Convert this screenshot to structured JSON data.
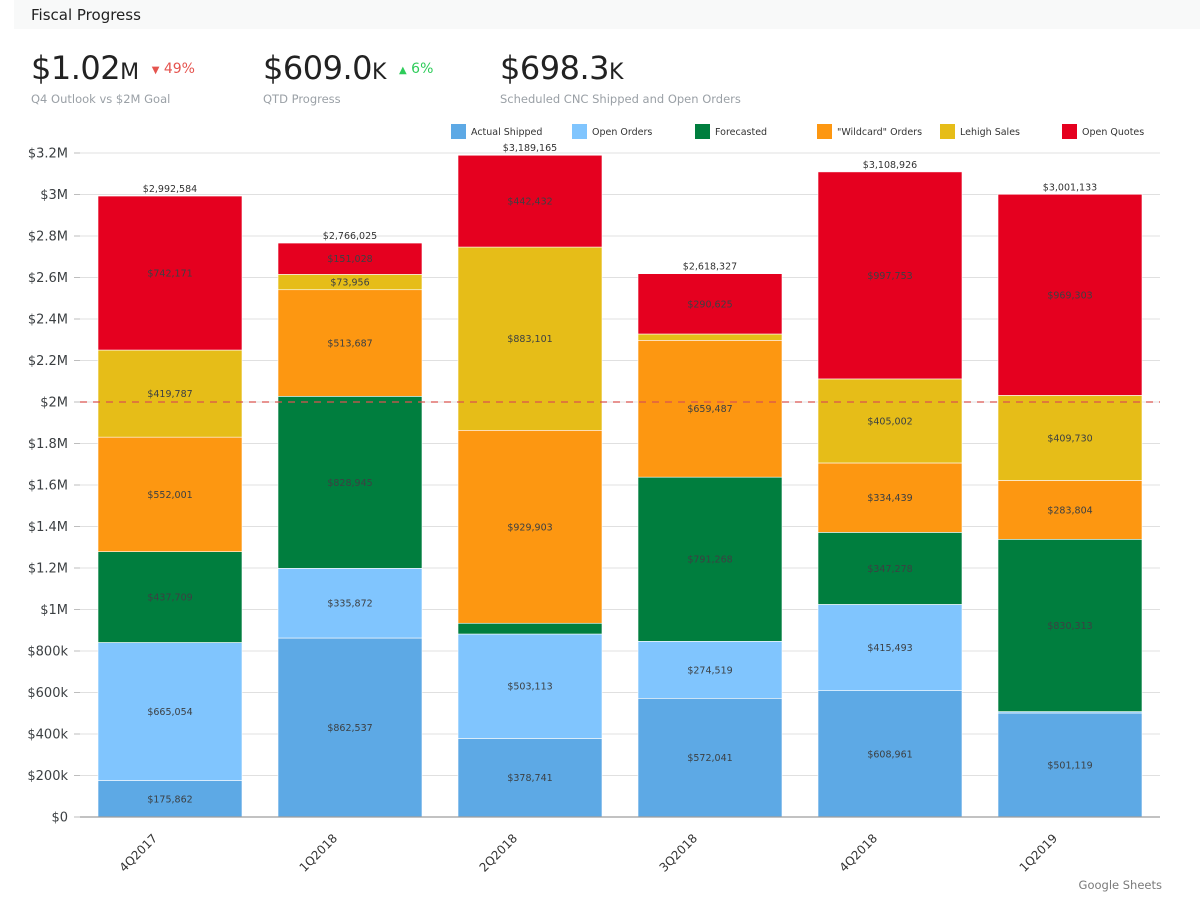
{
  "page": {
    "title": "Fiscal Progress",
    "footer": "Google Sheets"
  },
  "kpis": [
    {
      "value": "$1.02",
      "suffix": "M",
      "delta": "49%",
      "delta_direction": "down",
      "delta_icon": "triangle-down-icon",
      "label": "Q4 Outlook vs $2M Goal"
    },
    {
      "value": "$609.0",
      "suffix": "K",
      "delta": "6%",
      "delta_direction": "up",
      "delta_icon": "triangle-up-icon",
      "label": "QTD Progress"
    },
    {
      "value": "$698.3",
      "suffix": "K",
      "delta": "",
      "delta_direction": "",
      "delta_icon": "",
      "label": "Scheduled CNC Shipped and Open Orders"
    }
  ],
  "colors": {
    "down": "#e5544f",
    "up": "#2ecc5a",
    "goal_line": "#d9534f",
    "gridline": "#e0e0e0",
    "axis": "#9e9e9e"
  },
  "chart_data": {
    "type": "bar",
    "stacked": true,
    "title": "",
    "xlabel": "",
    "ylabel": "",
    "ylim": [
      0,
      3200000
    ],
    "y_ticks": [
      0,
      200000,
      400000,
      600000,
      800000,
      1000000,
      1200000,
      1400000,
      1600000,
      1800000,
      2000000,
      2200000,
      2400000,
      2600000,
      2800000,
      3000000,
      3200000
    ],
    "y_tick_labels": [
      "$0",
      "$200k",
      "$400k",
      "$600k",
      "$800k",
      "$1M",
      "$1.2M",
      "$1.4M",
      "$1.6M",
      "$1.8M",
      "$2M",
      "$2.2M",
      "$2.4M",
      "$2.6M",
      "$2.8M",
      "$3M",
      "$3.2M"
    ],
    "grid": true,
    "legend_position": "top",
    "categories": [
      "4Q2017",
      "1Q2018",
      "2Q2018",
      "3Q2018",
      "4Q2018",
      "1Q2019"
    ],
    "series": [
      {
        "name": "Actual Shipped",
        "color": "#5da9e5",
        "values": [
          175862,
          862537,
          378741,
          572041,
          608961,
          501119
        ],
        "labels": [
          "$175,862",
          "$862,537",
          "$378,741",
          "$572,041",
          "$608,961",
          "$501,119"
        ]
      },
      {
        "name": "Open Orders",
        "color": "#80c5fe",
        "values": [
          665054,
          335872,
          503113,
          274519,
          415493,
          6864
        ],
        "labels": [
          "$665,054",
          "$335,872",
          "$503,113",
          "$274,519",
          "$415,493",
          ""
        ]
      },
      {
        "name": "Forecasted",
        "color": "#007e3e",
        "values": [
          437709,
          828945,
          51875,
          791268,
          347278,
          830313
        ],
        "labels": [
          "$437,709",
          "$828,945",
          "",
          "$791,268",
          "$347,278",
          "$830,313"
        ]
      },
      {
        "name": "\"Wildcard\" Orders",
        "color": "#fd9711",
        "values": [
          552001,
          513687,
          929903,
          659487,
          334439,
          283804
        ],
        "labels": [
          "$552,001",
          "$513,687",
          "$929,903",
          "$659,487",
          "$334,439",
          "$283,804"
        ]
      },
      {
        "name": "Lehigh Sales",
        "color": "#e6bd18",
        "values": [
          419787,
          73956,
          883101,
          30387,
          405002,
          409730
        ],
        "labels": [
          "$419,787",
          "$73,956",
          "$883,101",
          "",
          "$405,002",
          "$409,730"
        ]
      },
      {
        "name": "Open Quotes",
        "color": "#e5001f",
        "values": [
          742171,
          151028,
          442432,
          290625,
          997753,
          969303
        ],
        "labels": [
          "$742,171",
          "$151,028",
          "$442,432",
          "$290,625",
          "$997,753",
          "$969,303"
        ]
      }
    ],
    "totals": [
      2992584,
      2766025,
      3189165,
      2618327,
      3108926,
      3001133
    ],
    "total_labels": [
      "$2,992,584",
      "$2,766,025",
      "$3,189,165",
      "$2,618,327",
      "$3,108,926",
      "$3,001,133"
    ],
    "annotations": [
      {
        "type": "reference-line",
        "value": 2000000,
        "style": "dashed",
        "label": ""
      }
    ]
  }
}
